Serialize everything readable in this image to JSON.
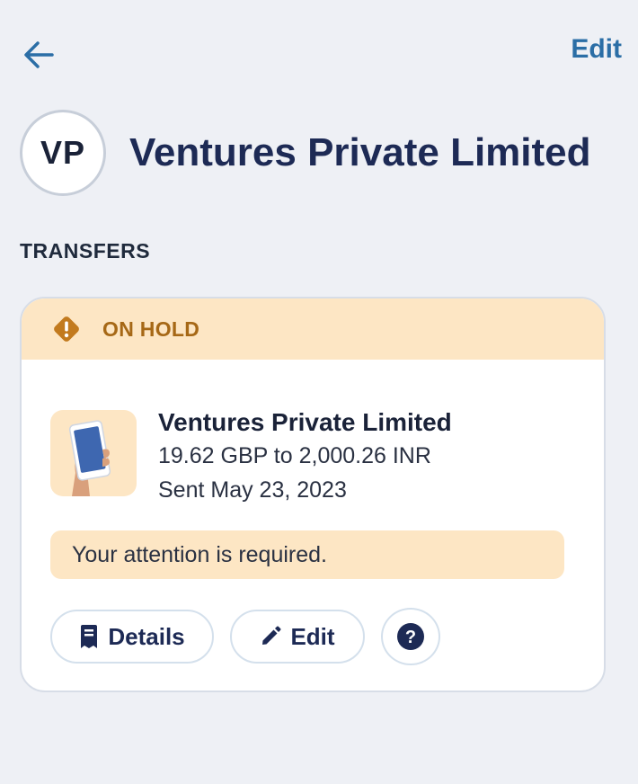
{
  "topbar": {
    "back_icon": "arrow-left-icon",
    "edit_label": "Edit"
  },
  "header": {
    "avatar_initials": "VP",
    "title": "Ventures Private Limited"
  },
  "section": {
    "heading": "TRANSFERS"
  },
  "transfer_card": {
    "status_icon": "warning-diamond-icon",
    "status_label": "ON HOLD",
    "thumbnail_icon": "phone-in-hand-icon",
    "recipient_name": "Ventures Private Limited",
    "amount_text": "19.62 GBP to 2,000.26 INR",
    "sent_date": "Sent May 23, 2023",
    "attention_text": "Your attention is required.",
    "actions": {
      "details_label": "Details",
      "details_icon": "receipt-icon",
      "edit_label": "Edit",
      "edit_icon": "pencil-icon",
      "help_icon": "question-circle-icon"
    }
  },
  "colors": {
    "background": "#eef0f5",
    "accent_link": "#2b6ea6",
    "title_navy": "#1d2a55",
    "hold_banner": "#fde6c4",
    "hold_text": "#a66816"
  }
}
